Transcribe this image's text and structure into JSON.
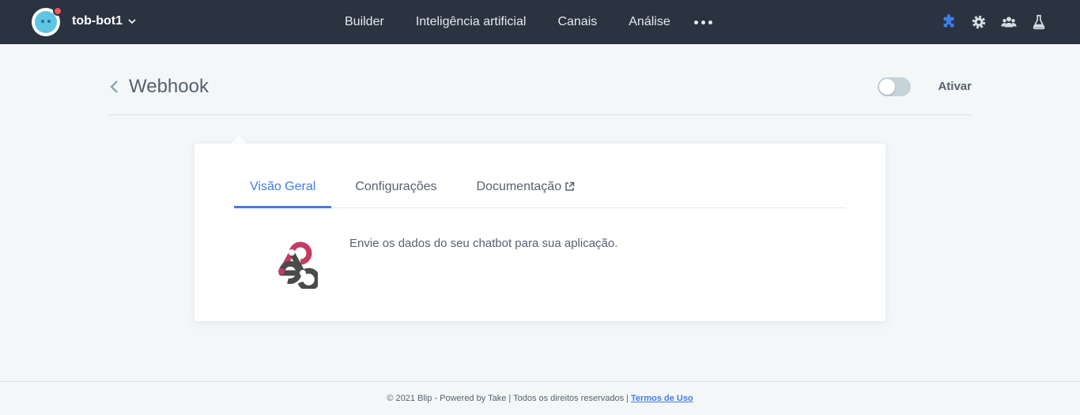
{
  "topbar": {
    "bot_name": "tob-bot1",
    "nav": [
      {
        "label": "Builder"
      },
      {
        "label": "Inteligência artificial"
      },
      {
        "label": "Canais"
      },
      {
        "label": "Análise"
      }
    ],
    "icons": [
      "puzzle-icon",
      "gear-icon",
      "team-icon",
      "flask-icon"
    ],
    "accent": "#3f7de8",
    "bg": "#2b3240"
  },
  "header": {
    "title": "Webhook",
    "toggle_label": "Ativar"
  },
  "card": {
    "tabs": [
      {
        "label": "Visão Geral",
        "active": true
      },
      {
        "label": "Configurações",
        "active": false
      },
      {
        "label": "Documentação",
        "active": false
      }
    ],
    "description": "Envie os dados do seu chatbot para sua aplicação."
  },
  "footer": {
    "text": "© 2021 Blip - Powered by Take | Todos os direitos reservados |",
    "link": "Termos de Uso"
  }
}
